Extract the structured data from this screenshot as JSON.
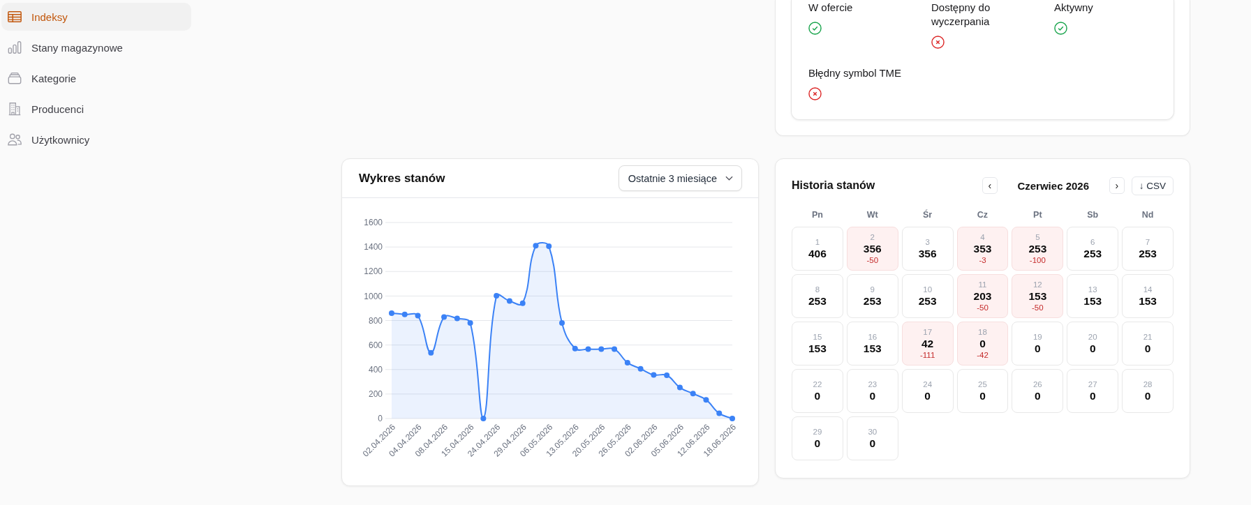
{
  "sidebar": {
    "items": [
      {
        "label": "Indeksy",
        "selected": true
      },
      {
        "label": "Stany magazynowe",
        "selected": false
      },
      {
        "label": "Kategorie",
        "selected": false
      },
      {
        "label": "Producenci",
        "selected": false
      },
      {
        "label": "Użytkownicy",
        "selected": false
      }
    ]
  },
  "status": {
    "items": [
      {
        "label": "W ofercie",
        "on": true
      },
      {
        "label": "Dostępny do wyczerpania",
        "on": false
      },
      {
        "label": "Aktywny",
        "on": true
      },
      {
        "label": "Błędny symbol TME",
        "on": false
      }
    ]
  },
  "stock_chart": {
    "title": "Wykres stanów",
    "range_select": {
      "value": "Ostatnie 3 miesiące"
    },
    "chart_data": {
      "type": "area",
      "grid": true,
      "categories": [
        "02.04.2026",
        null,
        "04.04.2026",
        null,
        "08.04.2026",
        null,
        "15.04.2026",
        null,
        "24.04.2026",
        null,
        "29.04.2026",
        null,
        "06.05.2026",
        null,
        "13.05.2026",
        null,
        "20.05.2026",
        null,
        "26.05.2026",
        null,
        "02.06.2026",
        null,
        "05.06.2026",
        null,
        "12.06.2026",
        null,
        "18.06.2026"
      ],
      "ylim": [
        0,
        1600
      ],
      "yticks": [
        0,
        200,
        400,
        600,
        800,
        1000,
        1200,
        1400,
        1600
      ],
      "values": [
        860,
        850,
        840,
        536,
        828,
        817,
        780,
        0,
        1002,
        959,
        941,
        1410,
        1407,
        780,
        571,
        566,
        566,
        566,
        456,
        406,
        356,
        353,
        253,
        203,
        153,
        42,
        0
      ]
    }
  },
  "stock_history": {
    "title": "Historia stanów",
    "prev_button": "‹",
    "month": "Czerwiec 2026",
    "next_button": "›",
    "csv_button": "↓ CSV",
    "weekdays": [
      "Pn",
      "Wt",
      "Śr",
      "Cz",
      "Pt",
      "Sb",
      "Nd"
    ],
    "days": [
      {
        "day": "1",
        "value": "406",
        "highlighted": false
      },
      {
        "day": "2",
        "value": "356",
        "change": "-50",
        "highlighted": true
      },
      {
        "day": "3",
        "value": "356",
        "highlighted": false
      },
      {
        "day": "4",
        "value": "353",
        "change": "-3",
        "highlighted": true
      },
      {
        "day": "5",
        "value": "253",
        "change": "-100",
        "highlighted": true
      },
      {
        "day": "6",
        "value": "253",
        "highlighted": false
      },
      {
        "day": "7",
        "value": "253",
        "highlighted": false
      },
      {
        "day": "8",
        "value": "253",
        "highlighted": false
      },
      {
        "day": "9",
        "value": "253",
        "highlighted": false
      },
      {
        "day": "10",
        "value": "253",
        "highlighted": false
      },
      {
        "day": "11",
        "value": "203",
        "change": "-50",
        "highlighted": true
      },
      {
        "day": "12",
        "value": "153",
        "change": "-50",
        "highlighted": true
      },
      {
        "day": "13",
        "value": "153",
        "highlighted": false
      },
      {
        "day": "14",
        "value": "153",
        "highlighted": false
      },
      {
        "day": "15",
        "value": "153",
        "highlighted": false
      },
      {
        "day": "16",
        "value": "153",
        "highlighted": false
      },
      {
        "day": "17",
        "value": "42",
        "change": "-111",
        "highlighted": true
      },
      {
        "day": "18",
        "value": "0",
        "change": "-42",
        "highlighted": true
      },
      {
        "day": "19",
        "value": "0",
        "highlighted": false
      },
      {
        "day": "20",
        "value": "0",
        "highlighted": false
      },
      {
        "day": "21",
        "value": "0",
        "highlighted": false
      },
      {
        "day": "22",
        "value": "0",
        "highlighted": false
      },
      {
        "day": "23",
        "value": "0",
        "highlighted": false
      },
      {
        "day": "24",
        "value": "0",
        "highlighted": false
      },
      {
        "day": "25",
        "value": "0",
        "highlighted": false
      },
      {
        "day": "26",
        "value": "0",
        "highlighted": false
      },
      {
        "day": "27",
        "value": "0",
        "highlighted": false
      },
      {
        "day": "28",
        "value": "0",
        "highlighted": false
      },
      {
        "day": "29",
        "value": "0",
        "highlighted": false
      },
      {
        "day": "30",
        "value": "0",
        "highlighted": false
      }
    ]
  }
}
